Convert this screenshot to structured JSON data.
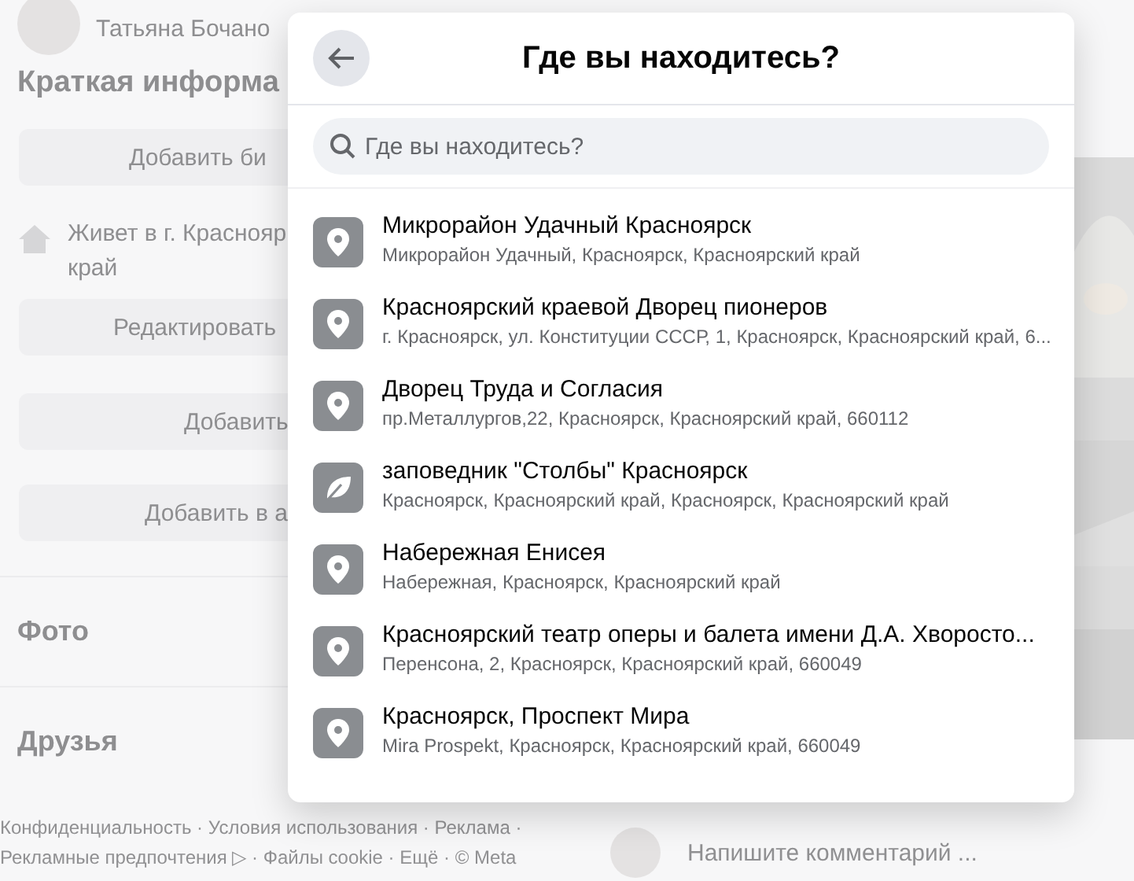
{
  "background": {
    "profile_name": "Татьяна Бочано",
    "intro_heading": "Краткая информа",
    "intro_buttons": [
      "Добавить би",
      "Редактировать",
      "Добавить",
      "Добавить в а"
    ],
    "lives_in": "Живет в г. Краснояр",
    "lives_in_cont": "край",
    "sections": [
      "Фото",
      "Друзья"
    ],
    "footer_lines": [
      "Конфиденциальность · Условия использования · Реклама ·",
      "Рекламные предпочтения ▷ · Файлы cookie · Ещё · © Meta"
    ],
    "comment_placeholder": "Напишите комментарий ..."
  },
  "dialog": {
    "title": "Где вы находитесь?",
    "search": {
      "placeholder": "Где вы находитесь?"
    },
    "places": [
      {
        "kind": "pin",
        "title": "Микрорайон Удачный Красноярск",
        "address": "Микрорайон Удачный, Красноярск, Красноярский край"
      },
      {
        "kind": "pin",
        "title": "Красноярский краевой Дворец пионеров",
        "address": "г. Красноярск, ул. Конституции СССР, 1, Красноярск, Красноярский край, 6..."
      },
      {
        "kind": "pin",
        "title": "Дворец Труда и Согласия",
        "address": "пр.Металлургов,22, Красноярск, Красноярский край, 660112"
      },
      {
        "kind": "leaf",
        "title": "заповедник \"Столбы\" Красноярск",
        "address": "Красноярск, Красноярский край, Красноярск, Красноярский край"
      },
      {
        "kind": "pin",
        "title": "Набережная Енисея",
        "address": "Набережная, Красноярск, Красноярский край"
      },
      {
        "kind": "pin",
        "title": "Красноярский театр оперы и балета имени Д.А. Хворосто...",
        "address": "Перенсона, 2, Красноярск, Красноярский край, 660049"
      },
      {
        "kind": "pin",
        "title": "Красноярск, Проспект Мира",
        "address": "Mira Prospekt, Красноярск, Красноярский край, 660049"
      }
    ]
  }
}
